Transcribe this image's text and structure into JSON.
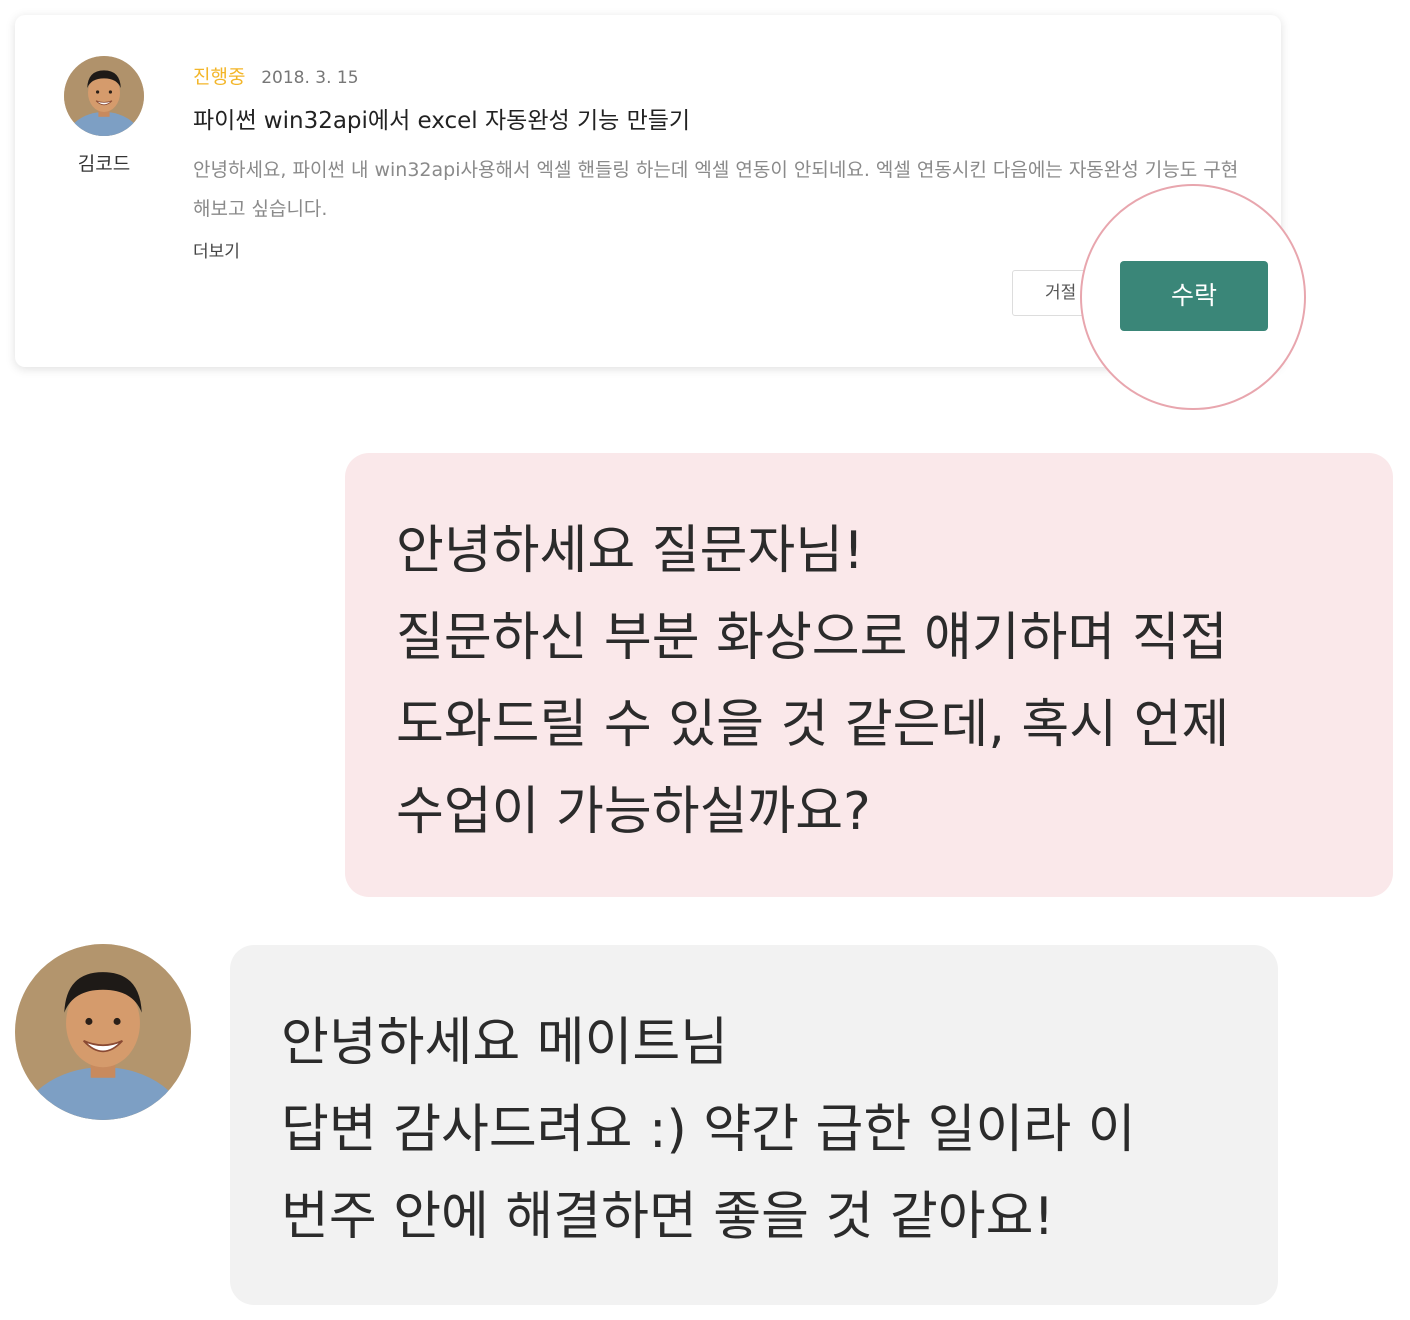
{
  "request_card": {
    "author_name": "김코드",
    "status": "진행중",
    "date": "2018. 3. 15",
    "title": "파이썬 win32api에서 excel 자동완성 기능 만들기",
    "description": "안녕하세요, 파이썬 내 win32api사용해서 엑셀 핸들링 하는데 엑셀 연동이 안되네요. 엑셀 연동시킨 다음에는 자동완성 기능도 구현해보고 싶습니다.",
    "more_label": "더보기",
    "reject_label": "거절",
    "accept_label": "수락",
    "colors": {
      "status": "#f3b62a",
      "accept": "#3a8678",
      "spotlight_ring": "#e8a6ae"
    }
  },
  "chat": {
    "mate_message": {
      "lines": [
        "안녕하세요 질문자님!",
        "질문하신 부분 화상으로 얘기하며 직접",
        "도와드릴 수 있을 것 같은데, 혹시 언제",
        "수업이 가능하실까요?"
      ],
      "color": "#fae8ea"
    },
    "user_message": {
      "lines": [
        "안녕하세요 메이트님",
        "답변 감사드려요 :) 약간 급한 일이라 이",
        "번주 안에 해결하면 좋을 것 같아요!"
      ],
      "color": "#f2f2f2"
    }
  }
}
